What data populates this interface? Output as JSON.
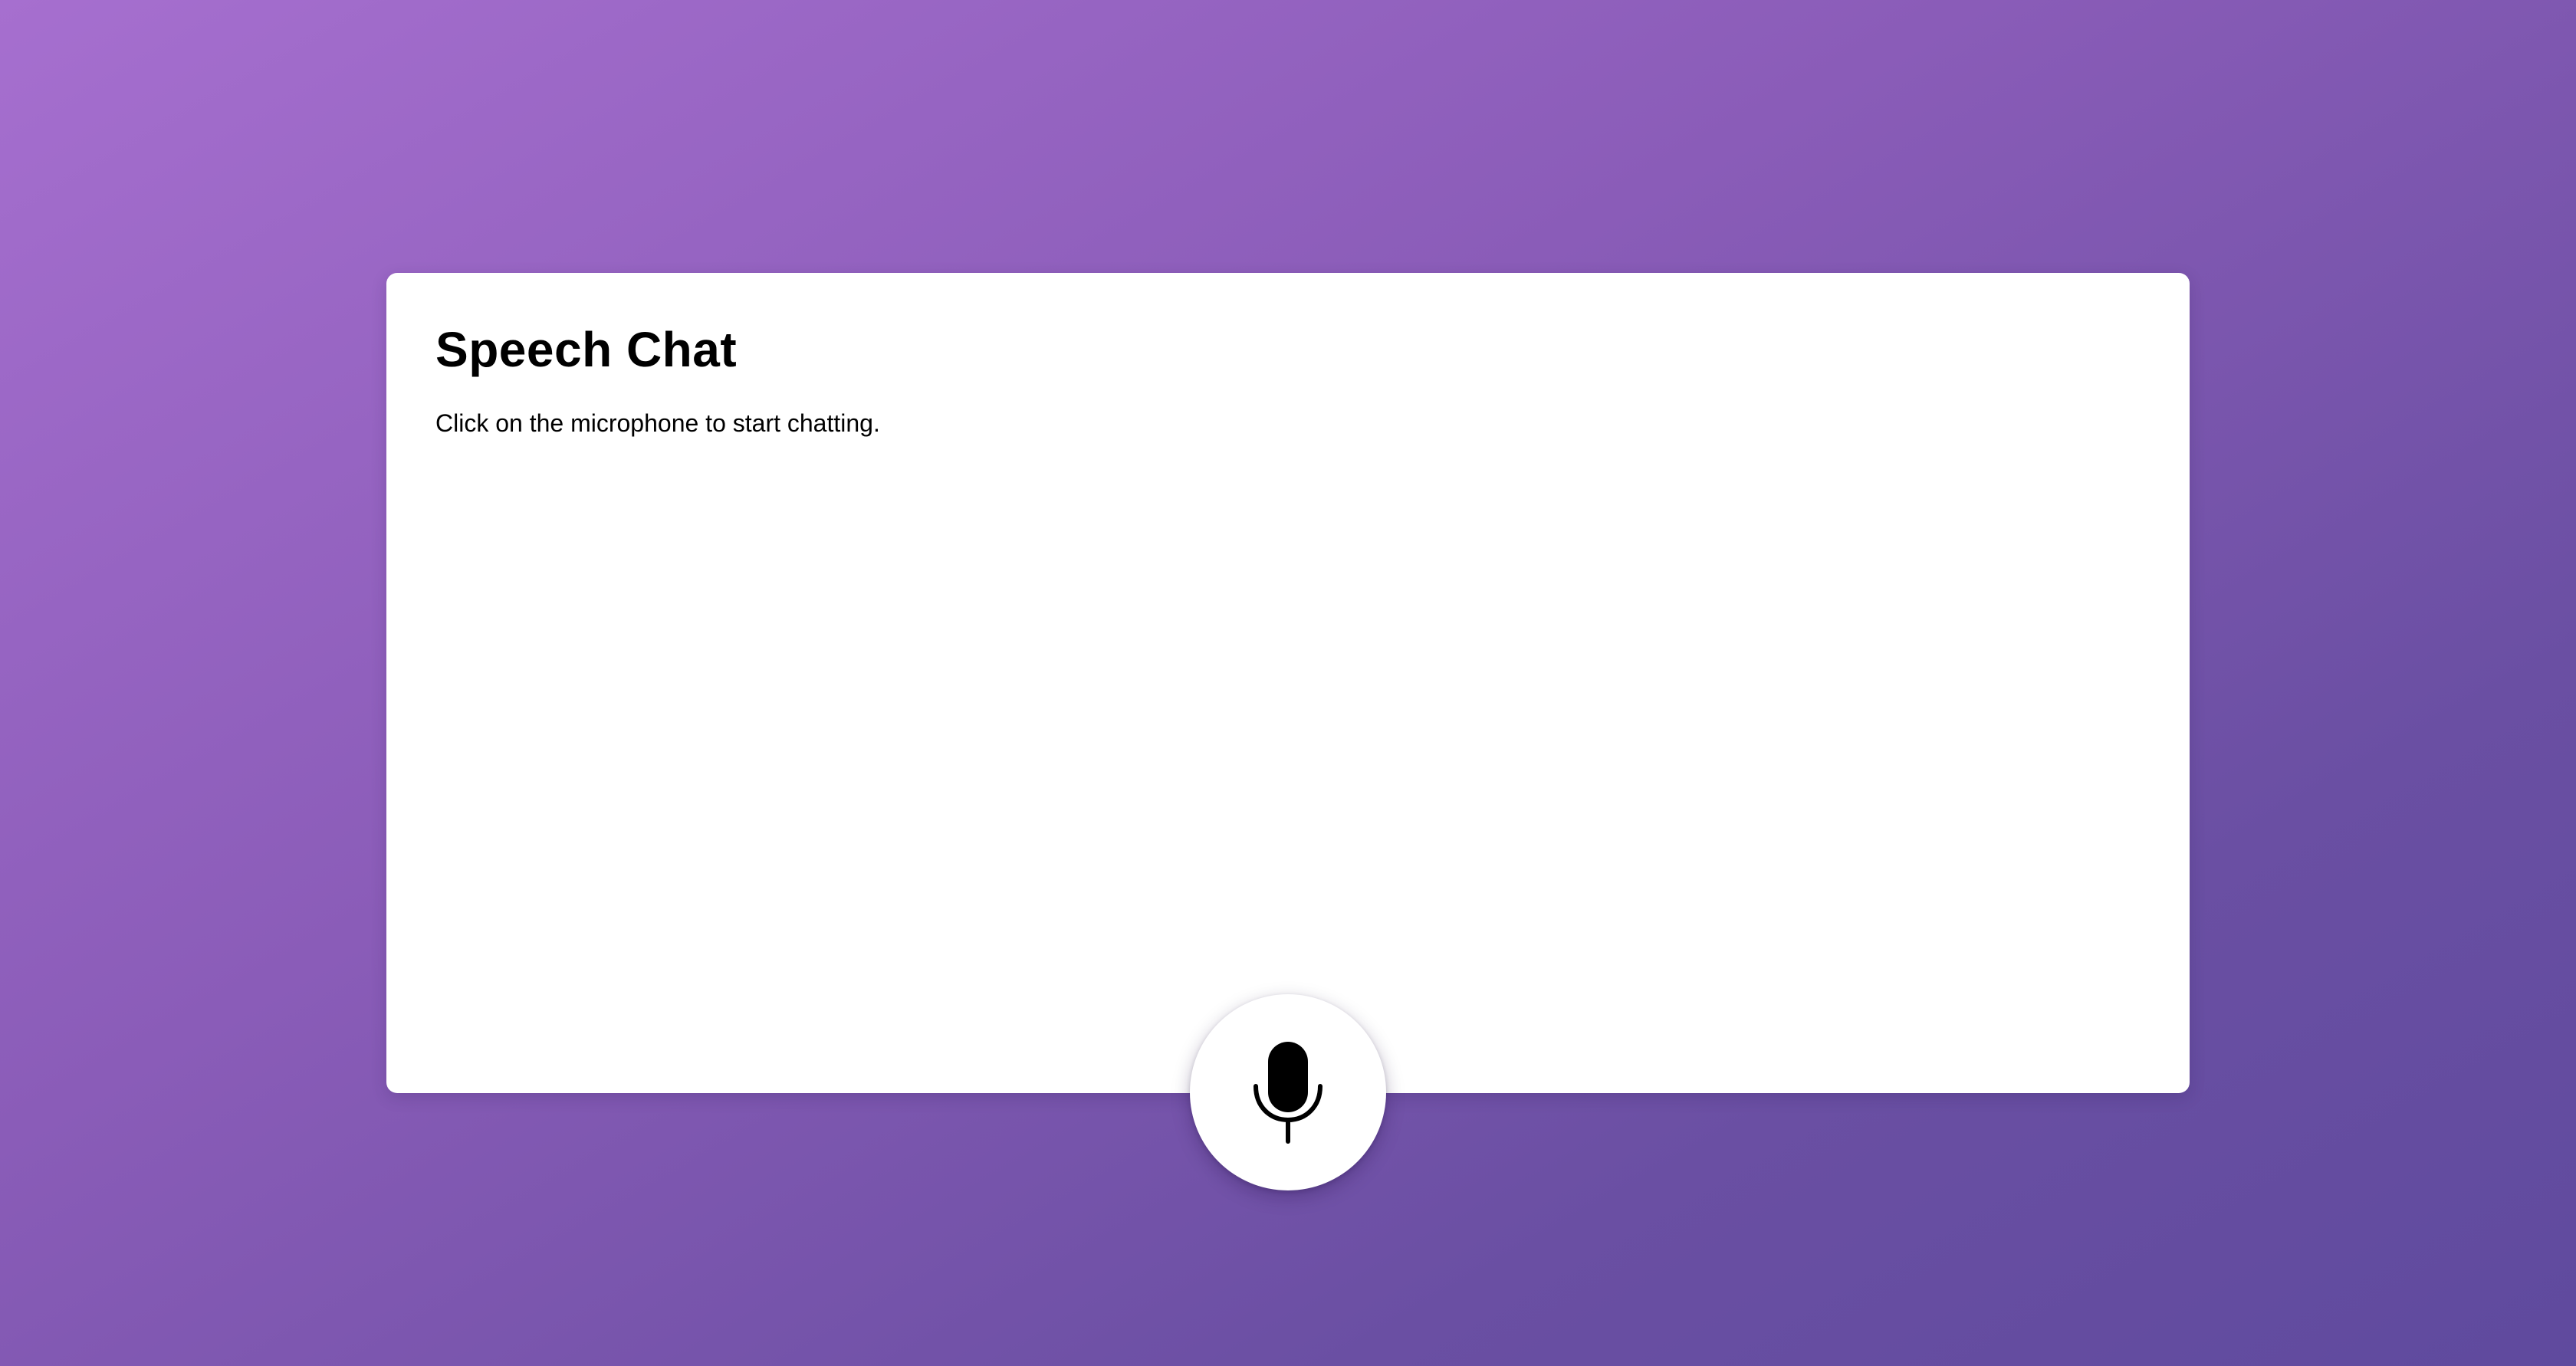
{
  "chat": {
    "title": "Speech Chat",
    "instructions": "Click on the microphone to start chatting."
  },
  "mic_button": {
    "icon": "microphone-icon"
  },
  "colors": {
    "background_gradient_start": "#a66fcf",
    "background_gradient_end": "#5f4a9e",
    "card": "#ffffff",
    "text": "#000000"
  }
}
